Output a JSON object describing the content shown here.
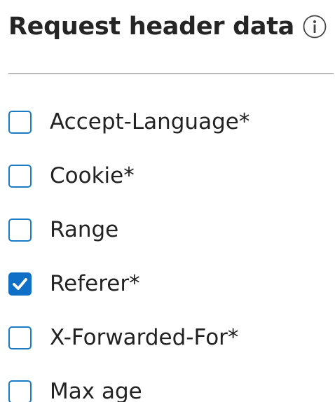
{
  "section": {
    "title": "Request header data",
    "info_icon": "info-circle-icon"
  },
  "options": [
    {
      "label": "Accept-Language*",
      "checked": false
    },
    {
      "label": "Cookie*",
      "checked": false
    },
    {
      "label": "Range",
      "checked": false
    },
    {
      "label": "Referer*",
      "checked": true
    },
    {
      "label": "X-Forwarded-For*",
      "checked": false
    },
    {
      "label": "Max age",
      "checked": false
    }
  ],
  "colors": {
    "checkbox_border": "#1b7bc5",
    "checkbox_checked": "#0f6fc6",
    "divider": "#b9b9b9"
  }
}
